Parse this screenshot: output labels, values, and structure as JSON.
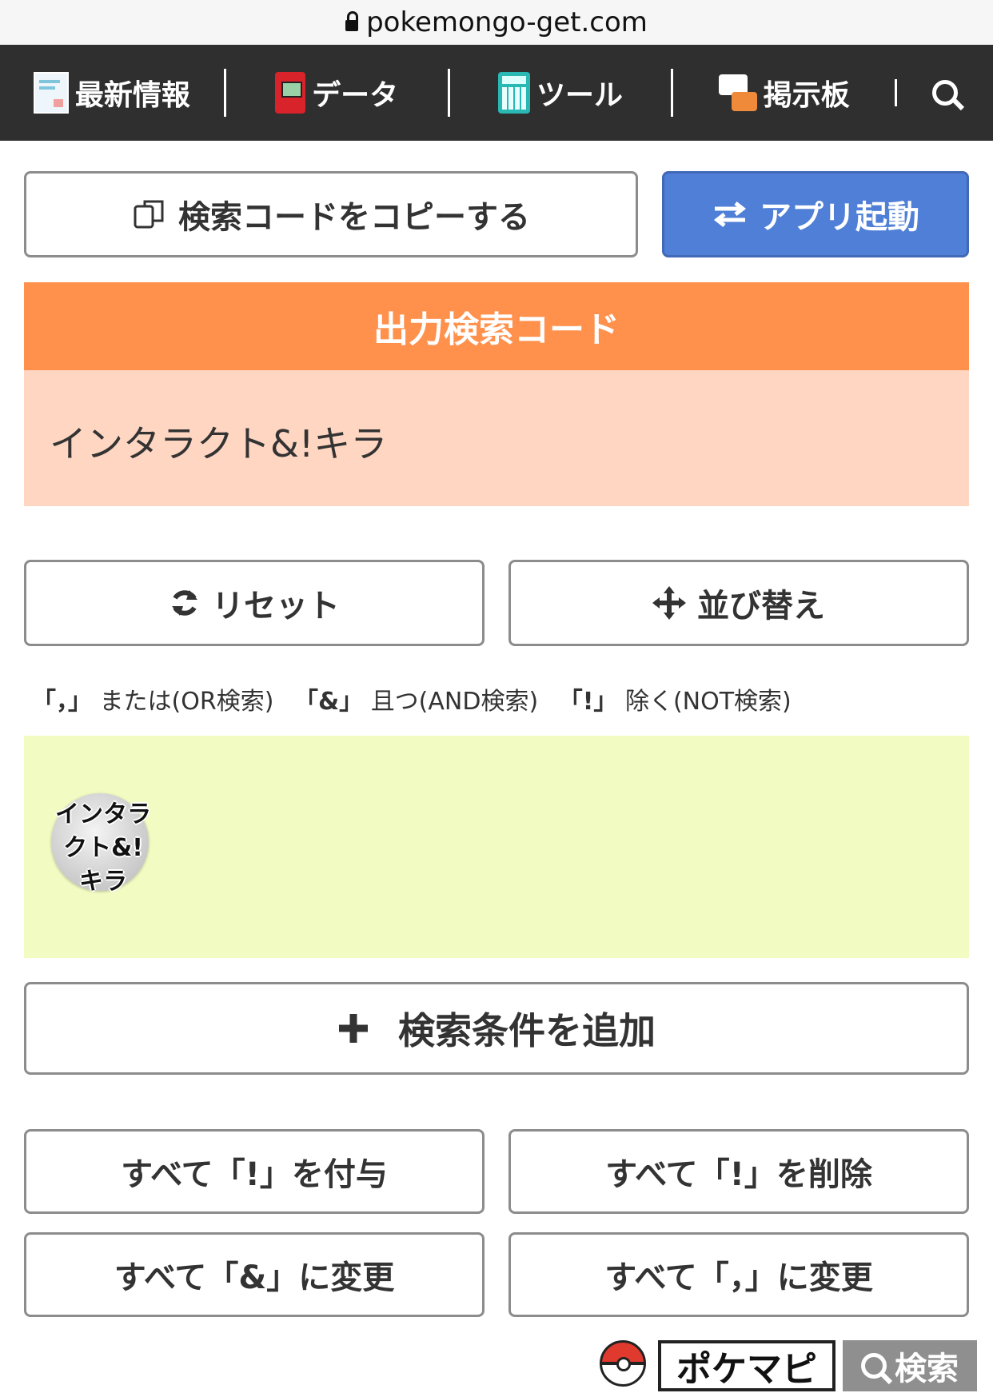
{
  "browser": {
    "url": "pokemongo-get.com"
  },
  "nav": {
    "items": [
      {
        "label": "最新情報",
        "icon": "news-icon"
      },
      {
        "label": "データ",
        "icon": "pokedex-icon"
      },
      {
        "label": "ツール",
        "icon": "calculator-icon"
      },
      {
        "label": "掲示板",
        "icon": "chat-icon"
      }
    ],
    "search_icon": "search-icon"
  },
  "actions": {
    "copy_label": "検索コードをコピーする",
    "app_label": "アプリ起動",
    "copy_icon": "copy-icon",
    "app_icon": "swap-arrows-icon"
  },
  "output": {
    "header": "出力検索コード",
    "code": "インタラクト&!キラ"
  },
  "controls": {
    "reset_label": "リセット",
    "sort_label": "並び替え",
    "reset_icon": "refresh-icon",
    "sort_icon": "move-icon"
  },
  "legend": {
    "or_symbol": "「，」",
    "or_text": "または(OR検索)",
    "and_symbol": "「&」",
    "and_text": "且つ(AND検索)",
    "not_symbol": "「!」",
    "not_text": "除く(NOT検索)"
  },
  "conditions": {
    "chips": [
      {
        "line1": "インタラ",
        "line2": "クト&!",
        "line3": "キラ"
      }
    ],
    "background_color": "#f1fbc2"
  },
  "add_condition_label": "検索条件を追加",
  "bulk": {
    "add_not": "すべて「!」を付与",
    "remove_not": "すべて「!」を削除",
    "to_and": "すべて「&」に変更",
    "to_or": "すべて「，」に変更"
  },
  "footer": {
    "brand": "ポケマピ",
    "search_label": "検索"
  },
  "colors": {
    "nav_bg": "#2f2f2f",
    "accent_orange": "#ff914d",
    "output_bg": "#ffd6c2",
    "app_button": "#4f7fd6"
  }
}
